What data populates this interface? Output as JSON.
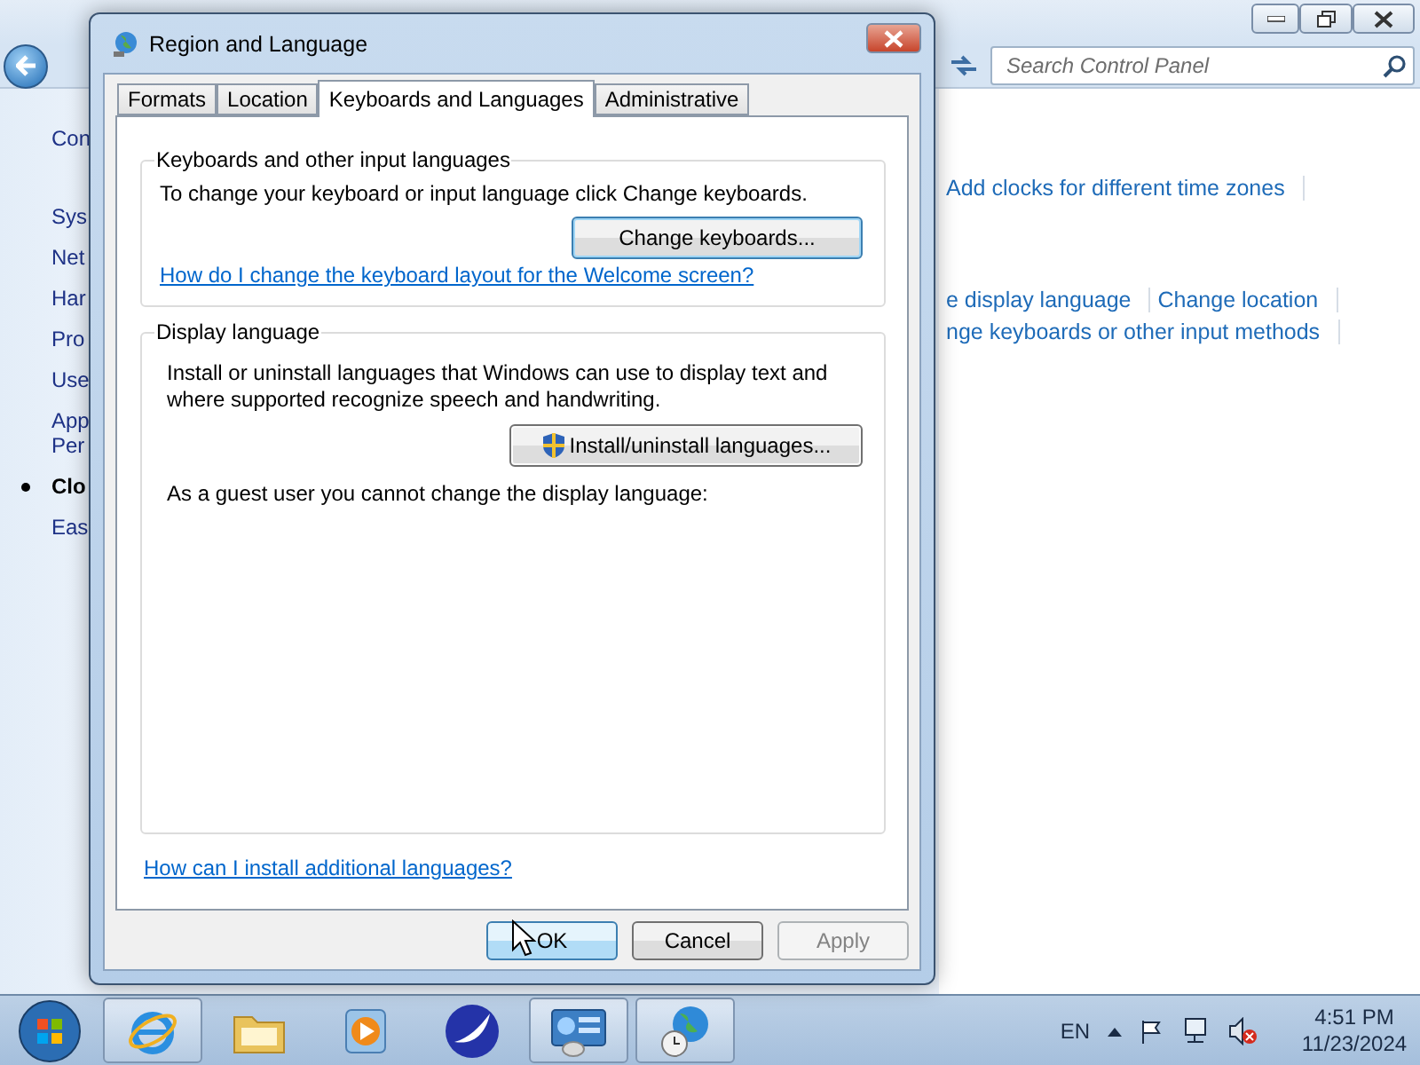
{
  "control_panel": {
    "search": {
      "placeholder": "Search Control Panel"
    },
    "home": "Con",
    "nav": [
      {
        "lines": [
          "Sys"
        ],
        "selected": false
      },
      {
        "lines": [
          "Net"
        ],
        "selected": false
      },
      {
        "lines": [
          "Har"
        ],
        "selected": false
      },
      {
        "lines": [
          "Pro"
        ],
        "selected": false
      },
      {
        "lines": [
          "Use"
        ],
        "selected": false
      },
      {
        "lines": [
          "App",
          "Per"
        ],
        "selected": false
      },
      {
        "lines": [
          "Clo"
        ],
        "selected": true
      },
      {
        "lines": [
          "Eas"
        ],
        "selected": false
      }
    ],
    "link_rows": [
      {
        "links": [
          "Add clocks for different time zones"
        ]
      },
      {
        "links": [
          "e display language",
          "Change location"
        ]
      },
      {
        "links": [
          "nge keyboards or other input methods"
        ]
      }
    ]
  },
  "dialog": {
    "title": "Region and Language",
    "tabs": [
      {
        "label": "Formats",
        "selected": false
      },
      {
        "label": "Location",
        "selected": false
      },
      {
        "label": "Keyboards and Languages",
        "selected": true
      },
      {
        "label": "Administrative",
        "selected": false
      }
    ],
    "keyboards_group": {
      "title": "Keyboards and other input languages",
      "text": "To change your keyboard or input language click Change keyboards.",
      "button": "Change keyboards...",
      "link": "How do I change the keyboard layout for the Welcome screen?"
    },
    "display_group": {
      "title": "Display language",
      "text": "Install or uninstall languages that Windows can use to display text and where supported recognize speech and handwriting.",
      "button": "Install/uninstall languages...",
      "note": "As a guest user you cannot change the display language:"
    },
    "help_link": "How can I install additional languages?",
    "buttons": [
      {
        "label": "OK",
        "kind": "default",
        "disabled": false
      },
      {
        "label": "Cancel",
        "kind": "normal",
        "disabled": false
      },
      {
        "label": "Apply",
        "kind": "normal",
        "disabled": true
      }
    ]
  },
  "taskbar": {
    "apps": [
      {
        "kind": "browser",
        "open": true
      },
      {
        "kind": "folder",
        "open": false
      },
      {
        "kind": "media",
        "open": false
      },
      {
        "kind": "bird",
        "open": false
      },
      {
        "kind": "panel",
        "open": true
      },
      {
        "kind": "globe",
        "open": true
      }
    ],
    "language": "EN",
    "time": "4:51 PM",
    "date": "11/23/2024"
  }
}
